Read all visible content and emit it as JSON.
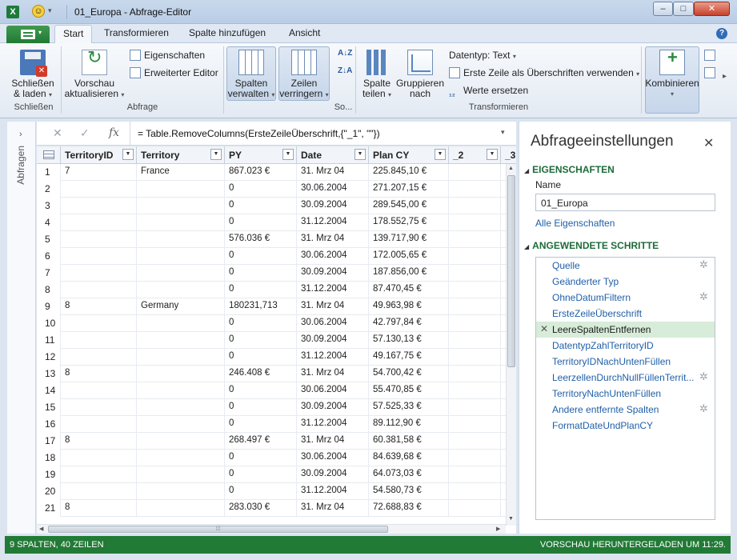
{
  "window": {
    "title": "01_Europa - Abfrage-Editor",
    "app_icon": "X",
    "controls": {
      "minimize": "–",
      "maximize": "□",
      "close": "✕"
    }
  },
  "ribbon": {
    "tabs": [
      {
        "label": "Start",
        "active": true
      },
      {
        "label": "Transformieren",
        "active": false
      },
      {
        "label": "Spalte hinzufügen",
        "active": false
      },
      {
        "label": "Ansicht",
        "active": false
      }
    ],
    "help": "?",
    "groups": {
      "close": {
        "name": "Schließen",
        "btn_line1": "Schließen",
        "btn_line2": "& laden"
      },
      "query": {
        "name": "Abfrage",
        "preview_line1": "Vorschau",
        "preview_line2": "aktualisieren",
        "properties": "Eigenschaften",
        "advanced_editor": "Erweiterter Editor"
      },
      "manage_columns": {
        "line1": "Spalten",
        "line2": "verwalten"
      },
      "reduce_rows": {
        "line1": "Zeilen",
        "line2": "verringern"
      },
      "sort": {
        "name": "So...",
        "asc": "A↓Z",
        "desc": "Z↓A"
      },
      "transform": {
        "name": "Transformieren",
        "split_line1": "Spalte",
        "split_line2": "teilen",
        "group_line1": "Gruppieren",
        "group_line2": "nach",
        "datatype": "Datentyp: Text",
        "first_row_headers": "Erste Zeile als Überschriften verwenden",
        "replace_values": "Werte ersetzen"
      },
      "combine": {
        "label": "Kombinieren"
      }
    }
  },
  "nav": {
    "label": "Abfragen"
  },
  "formula": {
    "cancel": "✕",
    "confirm": "✓",
    "fx": "fx",
    "text": "= Table.RemoveColumns(ErsteZeileÜberschrift,{\"_1\", \"\"})"
  },
  "table": {
    "columns": [
      "TerritoryID",
      "Territory",
      "PY",
      "Date",
      "Plan CY",
      "_2",
      "_3"
    ],
    "rows": [
      [
        "1",
        "7",
        "France",
        "867.023 €",
        "31. Mrz 04",
        "225.845,10 €"
      ],
      [
        "2",
        "",
        "",
        "0",
        "30.06.2004",
        "271.207,15 €"
      ],
      [
        "3",
        "",
        "",
        "0",
        "30.09.2004",
        "289.545,00 €"
      ],
      [
        "4",
        "",
        "",
        "0",
        "31.12.2004",
        "178.552,75 €"
      ],
      [
        "5",
        "",
        "",
        "576.036 €",
        "31. Mrz 04",
        "139.717,90 €"
      ],
      [
        "6",
        "",
        "",
        "0",
        "30.06.2004",
        "172.005,65 €"
      ],
      [
        "7",
        "",
        "",
        "0",
        "30.09.2004",
        "187.856,00 €"
      ],
      [
        "8",
        "",
        "",
        "0",
        "31.12.2004",
        "87.470,45 €"
      ],
      [
        "9",
        "8",
        "Germany",
        "180231,713",
        "31. Mrz 04",
        "49.963,98 €"
      ],
      [
        "10",
        "",
        "",
        "0",
        "30.06.2004",
        "42.797,84 €"
      ],
      [
        "11",
        "",
        "",
        "0",
        "30.09.2004",
        "57.130,13 €"
      ],
      [
        "12",
        "",
        "",
        "0",
        "31.12.2004",
        "49.167,75 €"
      ],
      [
        "13",
        "8",
        "",
        "246.408 €",
        "31. Mrz 04",
        "54.700,42 €"
      ],
      [
        "14",
        "",
        "",
        "0",
        "30.06.2004",
        "55.470,85 €"
      ],
      [
        "15",
        "",
        "",
        "0",
        "30.09.2004",
        "57.525,33 €"
      ],
      [
        "16",
        "",
        "",
        "0",
        "31.12.2004",
        "89.112,90 €"
      ],
      [
        "17",
        "8",
        "",
        "268.497 €",
        "31. Mrz 04",
        "60.381,58 €"
      ],
      [
        "18",
        "",
        "",
        "0",
        "30.06.2004",
        "84.639,68 €"
      ],
      [
        "19",
        "",
        "",
        "0",
        "30.09.2004",
        "64.073,03 €"
      ],
      [
        "20",
        "",
        "",
        "0",
        "31.12.2004",
        "54.580,73 €"
      ],
      [
        "21",
        "8",
        "",
        "283.030 €",
        "31. Mrz 04",
        "72.688,83 €"
      ]
    ]
  },
  "settings": {
    "title": "Abfrageeinstellungen",
    "close": "✕",
    "properties_header": "EIGENSCHAFTEN",
    "name_label": "Name",
    "name_value": "01_Europa",
    "all_properties": "Alle Eigenschaften",
    "steps_header": "ANGEWENDETE SCHRITTE",
    "steps": [
      {
        "label": "Quelle",
        "gear": true,
        "selected": false
      },
      {
        "label": "Geänderter Typ",
        "gear": false,
        "selected": false
      },
      {
        "label": "OhneDatumFiltern",
        "gear": true,
        "selected": false
      },
      {
        "label": "ErsteZeileÜberschrift",
        "gear": false,
        "selected": false
      },
      {
        "label": "LeereSpaltenEntfernen",
        "gear": false,
        "selected": true
      },
      {
        "label": "DatentypZahlTerritoryID",
        "gear": false,
        "selected": false
      },
      {
        "label": "TerritoryIDNachUntenFüllen",
        "gear": false,
        "selected": false
      },
      {
        "label": "LeerzellenDurchNullFüllenTerrit...",
        "gear": true,
        "selected": false
      },
      {
        "label": "TerritoryNachUntenFüllen",
        "gear": false,
        "selected": false
      },
      {
        "label": "Andere entfernte Spalten",
        "gear": true,
        "selected": false
      },
      {
        "label": "FormatDateUndPlanCY",
        "gear": false,
        "selected": false
      }
    ]
  },
  "status": {
    "left": "9 SPALTEN, 40 ZEILEN",
    "right": "VORSCHAU HERUNTERGELADEN UM 11:29."
  }
}
